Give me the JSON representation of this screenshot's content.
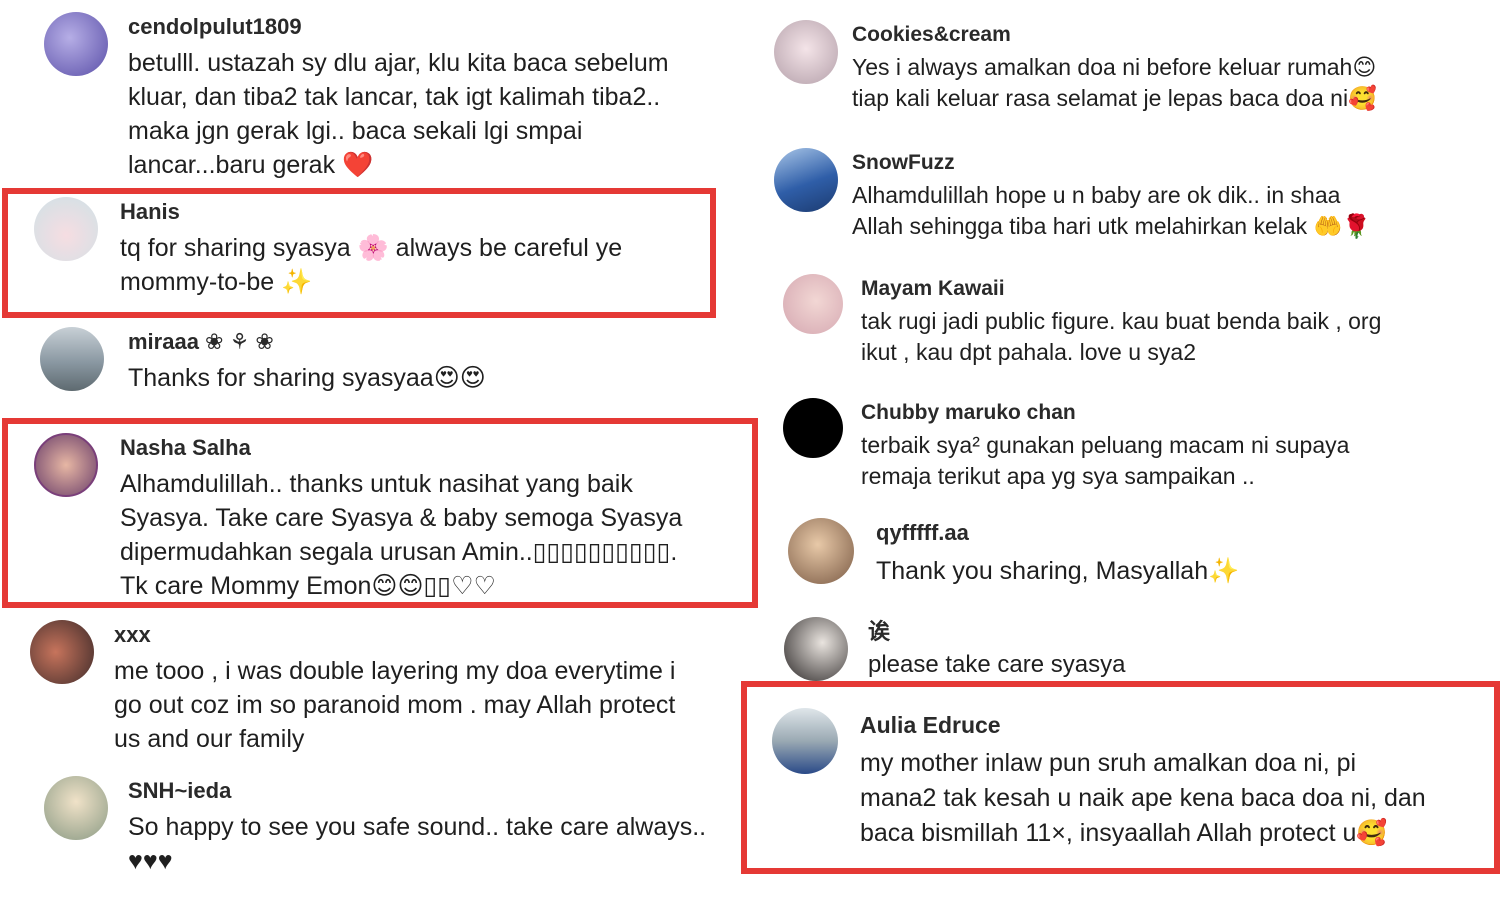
{
  "left_column": [
    {
      "username": "cendolpulut1809",
      "text": "betulll. ustazah sy dlu ajar, klu kita baca sebelum\nkluar, dan tiba2 tak lancar, tak igt kalimah tiba2..\nmaka jgn gerak lgi.. baca sekali lgi smpai\nlancar...baru gerak ❤️",
      "avatar_color": "#7b6fc4"
    },
    {
      "username": "Hanis",
      "text": "tq for sharing syasya 🌸 always be careful ye\nmommy-to-be ✨",
      "avatar_color": "#dfe8ea"
    },
    {
      "username": "miraaa ❀ ⚘ ❀",
      "text": "Thanks for sharing syasyaa😍😍",
      "avatar_color": "#9aa6ad"
    },
    {
      "username": "Nasha Salha",
      "text": "Alhamdulillah.. thanks untuk nasihat yang baik\nSyasya. Take care Syasya & baby semoga Syasya\ndipermudahkan segala urusan Amin..▯▯▯▯▯▯▯▯▯▯.\nTk care Mommy Emon😊😊▯▯♡♡",
      "avatar_color": "#8a5a7a"
    },
    {
      "username": "xxx",
      "text": "me tooo , i was double layering my doa everytime i\ngo out coz im so paranoid mom . may Allah protect\nus and our family",
      "avatar_color": "#8c4a3c"
    },
    {
      "username": "SNH~ieda",
      "text": "So happy to see you safe sound.. take care always..\n♥♥♥",
      "avatar_color": "#c4b89a"
    }
  ],
  "right_column": [
    {
      "username": "Cookies&cream",
      "text": "Yes i always amalkan doa ni before keluar rumah😊\ntiap kali keluar rasa selamat je lepas baca doa ni🥰",
      "avatar_color": "#d7c6cf"
    },
    {
      "username": "SnowFuzz",
      "text": "Alhamdulillah hope u n baby are ok dik.. in shaa\nAllah sehingga tiba hari utk melahirkan kelak 🤲🌹",
      "avatar_color": "#2f5ea8"
    },
    {
      "username": "Mayam Kawaii",
      "text": "tak rugi jadi public figure. kau buat benda baik , org\nikut , kau dpt pahala. love u sya2",
      "avatar_color": "#e3c1c4"
    },
    {
      "username": "Chubby maruko chan",
      "text": "terbaik sya² gunakan peluang macam ni supaya\nremaja terikut apa yg sya sampaikan ..",
      "avatar_color": "#000000"
    },
    {
      "username": "qyfffff.aa",
      "text": "Thank you sharing, Masyallah✨",
      "avatar_color": "#b58b6a"
    },
    {
      "username": "诶",
      "text": "please take care syasya",
      "avatar_color": "#3c3a3a"
    },
    {
      "username": "Aulia Edruce",
      "text": "my mother inlaw pun sruh amalkan doa ni, pi\nmana2 tak kesah u naik ape kena baca doa ni, dan\nbaca bismillah 11×, insyaallah Allah protect u🥰",
      "avatar_color": "#7d8f9d"
    }
  ],
  "colors": {
    "highlight": "#e53935",
    "text": "#1f1f1f"
  }
}
